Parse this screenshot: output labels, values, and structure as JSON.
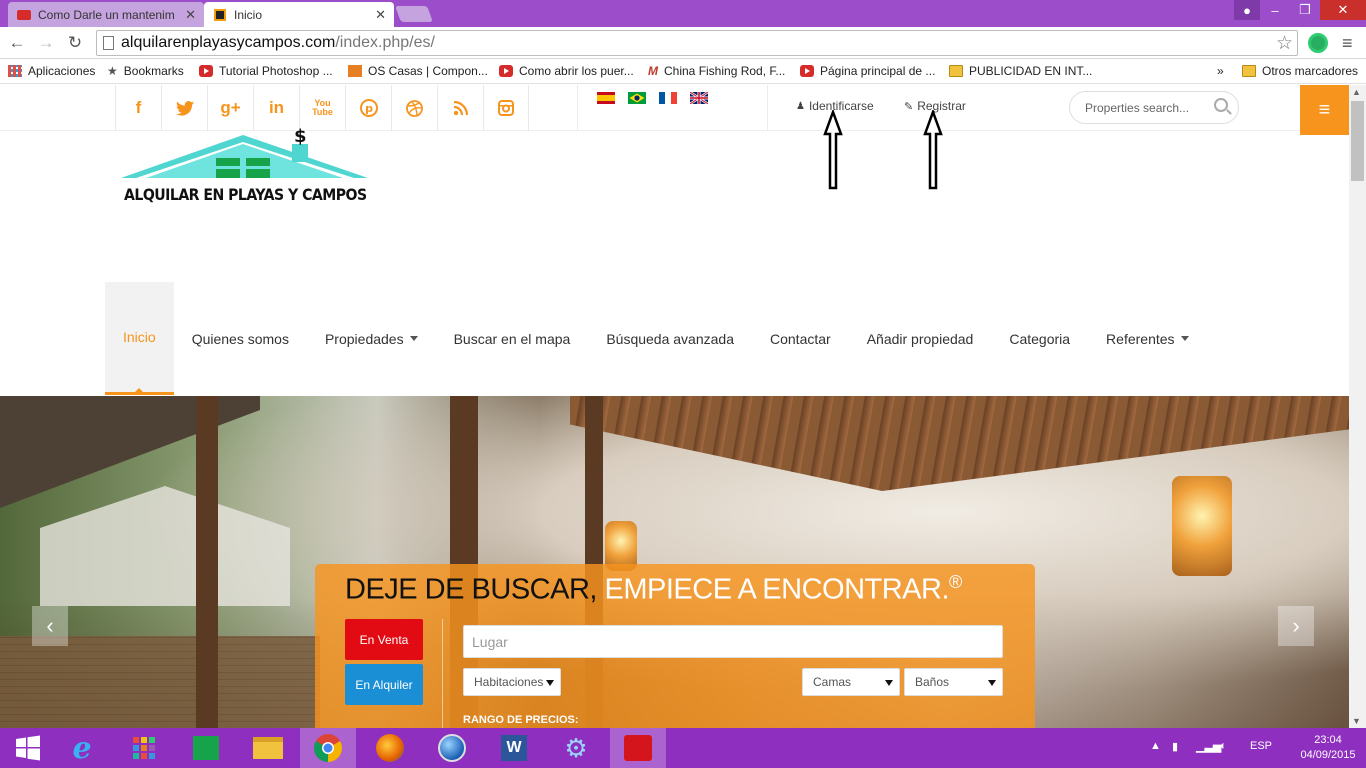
{
  "browser": {
    "tabs": [
      {
        "label": "Como Darle un mantenim",
        "active": false
      },
      {
        "label": "Inicio",
        "active": true
      }
    ],
    "url_host": "alquilarenplayasycampos.com",
    "url_path": "/index.php/es/",
    "bookmarks": [
      {
        "label": "Aplicaciones",
        "icon": "apps-grid-icon"
      },
      {
        "label": "Bookmarks",
        "icon": "star-icon"
      },
      {
        "label": "Tutorial Photoshop ...",
        "icon": "youtube-icon"
      },
      {
        "label": "OS Casas | Compon...",
        "icon": "os-icon"
      },
      {
        "label": "Como abrir los puer...",
        "icon": "youtube-icon"
      },
      {
        "label": "China Fishing Rod, F...",
        "icon": "m-icon"
      },
      {
        "label": "Página principal de ...",
        "icon": "youtube-icon"
      },
      {
        "label": "PUBLICIDAD EN INT...",
        "icon": "folder-icon"
      }
    ],
    "overflow": "»",
    "other_bookmarks": "Otros marcadores"
  },
  "site": {
    "social": [
      "f",
      "twitter",
      "g+",
      "in",
      "YouTube",
      "pinterest",
      "dribbble",
      "rss",
      "instagram"
    ],
    "login": "Identificarse",
    "register": "Registrar",
    "search_placeholder": "Properties search...",
    "logo_text": "ALQUILAR EN PLAYAS Y CAMPOS",
    "logo_mark": "$",
    "nav": [
      {
        "label": "Inicio",
        "active": true,
        "caret": false
      },
      {
        "label": "Quienes somos",
        "active": false,
        "caret": false
      },
      {
        "label": "Propiedades",
        "active": false,
        "caret": true
      },
      {
        "label": "Buscar en el mapa",
        "active": false,
        "caret": false
      },
      {
        "label": "Búsqueda avanzada",
        "active": false,
        "caret": false
      },
      {
        "label": "Contactar",
        "active": false,
        "caret": false
      },
      {
        "label": "Añadir propiedad",
        "active": false,
        "caret": false
      },
      {
        "label": "Categoria",
        "active": false,
        "caret": false
      },
      {
        "label": "Referentes",
        "active": false,
        "caret": true
      }
    ],
    "hero": {
      "headline_dark": "DEJE DE BUSCAR,",
      "headline_light": "EMPIECE A ENCONTRAR.",
      "headline_mark": "®",
      "btn_sale": "En Venta",
      "btn_rent": "En Alquiler",
      "place_placeholder": "Lugar",
      "rooms": "Habitaciones",
      "beds": "Camas",
      "baths": "Baños",
      "price_range": "RANGO DE PRECIOS:"
    },
    "accent_color": "#f7941e"
  },
  "taskbar": {
    "lang": "ESP",
    "time": "23:04",
    "date": "04/09/2015"
  }
}
